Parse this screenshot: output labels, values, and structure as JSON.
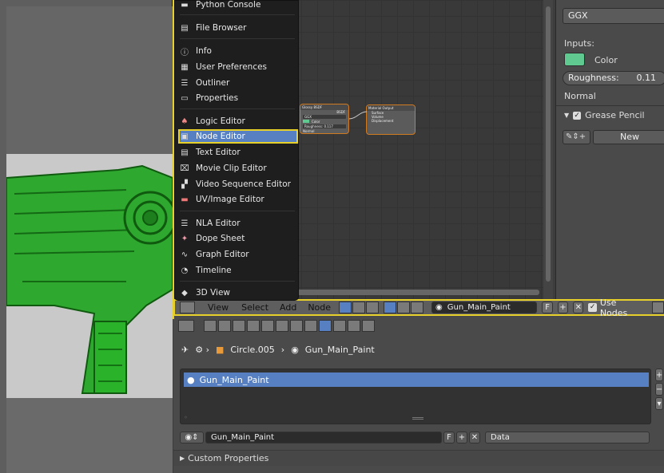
{
  "editor_menu": {
    "items": [
      {
        "label": "Python Console",
        "icon": "python-icon"
      },
      {
        "label": "File Browser",
        "icon": "folder-icon"
      },
      {
        "label": "Info",
        "icon": "info-icon"
      },
      {
        "label": "User Preferences",
        "icon": "preferences-icon"
      },
      {
        "label": "Outliner",
        "icon": "outliner-icon"
      },
      {
        "label": "Properties",
        "icon": "properties-icon"
      },
      {
        "label": "Logic Editor",
        "icon": "logic-icon"
      },
      {
        "label": "Node Editor",
        "icon": "node-icon"
      },
      {
        "label": "Text Editor",
        "icon": "text-icon"
      },
      {
        "label": "Movie Clip Editor",
        "icon": "clip-icon"
      },
      {
        "label": "Video Sequence Editor",
        "icon": "sequence-icon"
      },
      {
        "label": "UV/Image Editor",
        "icon": "image-icon"
      },
      {
        "label": "NLA Editor",
        "icon": "nla-icon"
      },
      {
        "label": "Dope Sheet",
        "icon": "dopesheet-icon"
      },
      {
        "label": "Graph Editor",
        "icon": "graph-icon"
      },
      {
        "label": "Timeline",
        "icon": "timeline-icon"
      },
      {
        "label": "3D View",
        "icon": "view3d-icon"
      }
    ],
    "active": "Node Editor"
  },
  "nodes": {
    "bsdf": {
      "title": "Glossy BSDF",
      "out": "BSDF",
      "dist": "GGX",
      "color": "Color",
      "rough": "Roughness: 0.117",
      "normal": "Normal"
    },
    "output": {
      "title": "Material Output",
      "s1": "Surface",
      "s2": "Volume",
      "s3": "Displacement"
    }
  },
  "props": {
    "distribution": "GGX",
    "inputs_label": "Inputs:",
    "color_label": "Color",
    "color_swatch": "#5fc98f",
    "roughness_label": "Roughness:",
    "roughness_value": "0.11",
    "normal_label": "Normal",
    "grease_pencil": "Grease Pencil",
    "new_button": "New"
  },
  "node_header": {
    "menus": [
      "View",
      "Select",
      "Add",
      "Node"
    ],
    "material": "Gun_Main_Paint",
    "fake_user": "F",
    "use_nodes": "Use Nodes"
  },
  "breadcrumb": {
    "object": "Circle.005",
    "material": "Gun_Main_Paint"
  },
  "material_slots": [
    {
      "name": "Gun_Main_Paint"
    }
  ],
  "material_selector": {
    "name": "Gun_Main_Paint",
    "fake_user": "F",
    "link": "Data"
  },
  "panels": {
    "custom_properties": "Custom Properties"
  },
  "colors": {
    "accent_yellow": "#e8d02a",
    "selection_blue": "#5680c2",
    "model_green": "#2fa82f"
  }
}
